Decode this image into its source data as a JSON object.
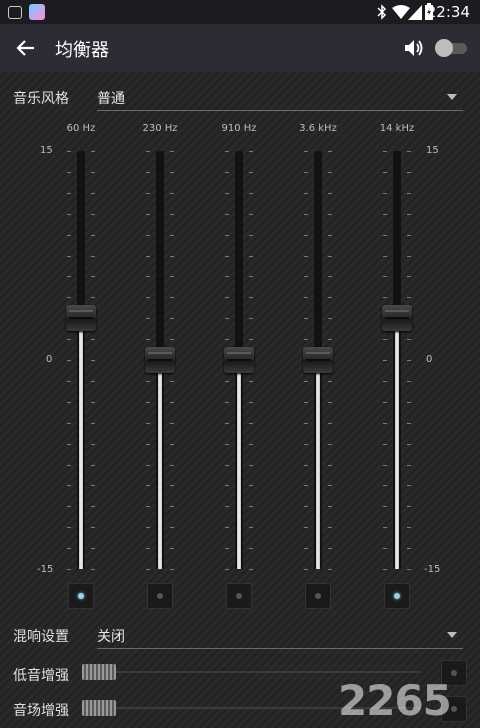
{
  "status_bar": {
    "time": "22:34",
    "icons": [
      "image-icon",
      "app-icon",
      "bluetooth-icon",
      "wifi-icon",
      "signal-icon",
      "battery-icon"
    ]
  },
  "app_bar": {
    "title": "均衡器",
    "back_icon": "arrow-left-icon",
    "volume_icon": "speaker-icon",
    "enabled": false
  },
  "preset": {
    "label": "音乐风格",
    "value": "普通"
  },
  "equalizer": {
    "scale_top": "15",
    "scale_mid": "0",
    "scale_bottom": "-15",
    "range": [
      -15,
      15
    ],
    "bands": [
      {
        "freq": "60 Hz",
        "level": 3,
        "active": true
      },
      {
        "freq": "230 Hz",
        "level": 0,
        "active": false
      },
      {
        "freq": "910 Hz",
        "level": 0,
        "active": false
      },
      {
        "freq": "3.6 kHz",
        "level": 0,
        "active": false
      },
      {
        "freq": "14 kHz",
        "level": 3,
        "active": true
      }
    ]
  },
  "reverb": {
    "label": "混响设置",
    "value": "关闭"
  },
  "bass_boost": {
    "label": "低音增强",
    "level": 0
  },
  "virtualizer": {
    "label": "音场增强",
    "level": 0
  },
  "watermark": "2265"
}
